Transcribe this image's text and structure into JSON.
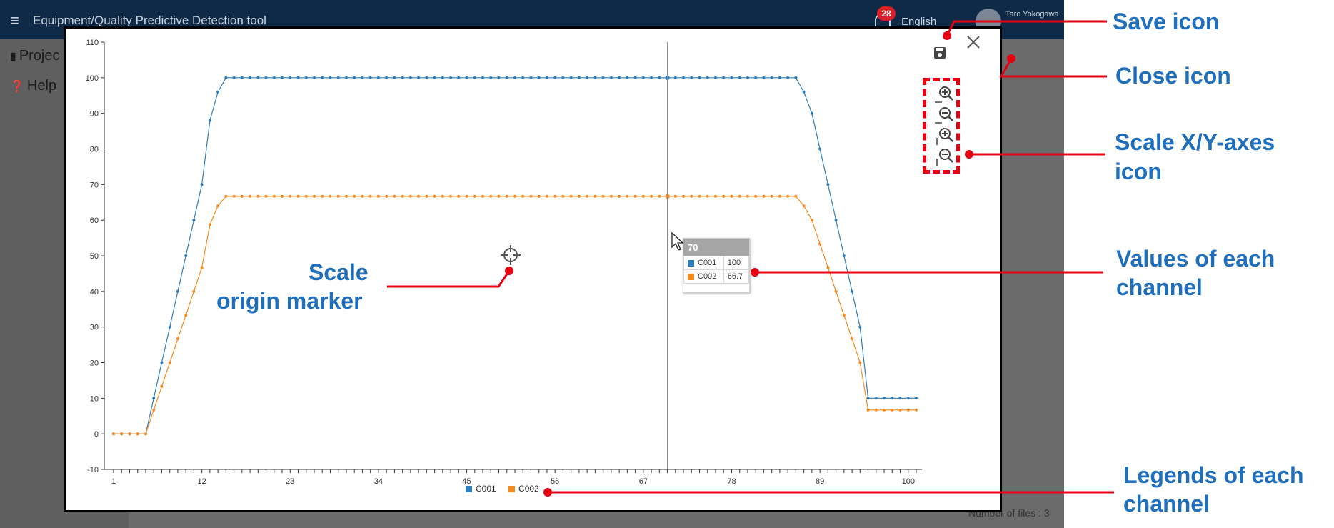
{
  "app": {
    "title": "Equipment/Quality Predictive Detection tool",
    "menu_icon": "hamburger-icon",
    "notification_count": "28",
    "language": "English",
    "user_name": "Taro Yokogawa",
    "sidebar_items": [
      {
        "label": "Projec",
        "icon": "bar-chart-icon"
      },
      {
        "label": "Help",
        "icon": "help-icon"
      }
    ],
    "files_count": "Number of files : 3"
  },
  "modal": {
    "save_icon": "save-icon",
    "close_icon": "close-icon",
    "zoom_icons": [
      "x-zoom-in-icon",
      "x-zoom-out-icon",
      "y-zoom-in-icon",
      "y-zoom-out-icon"
    ],
    "origin_marker_icon": "crosshair-icon"
  },
  "tooltip": {
    "x": "70",
    "rows": [
      {
        "channel": "C001",
        "value": "100",
        "color": "#2f7ebc"
      },
      {
        "channel": "C002",
        "value": "66.7",
        "color": "#f58a1f"
      }
    ]
  },
  "annotations": {
    "save": "Save icon",
    "close": "Close icon",
    "scale_line1": "Scale X/Y-axes",
    "scale_line2": "icon",
    "values_line1": "Values of each",
    "values_line2": "channel",
    "origin_line1": "Scale",
    "origin_line2": "origin marker",
    "legend_line1": "Legends of each",
    "legend_line2": "channel"
  },
  "chart_data": {
    "type": "line",
    "title": "",
    "xlabel": "",
    "ylabel": "",
    "xlim": [
      1,
      101
    ],
    "ylim": [
      -10,
      110
    ],
    "x_ticks": [
      1,
      12,
      23,
      34,
      45,
      56,
      67,
      78,
      89,
      100
    ],
    "y_ticks": [
      -10,
      0,
      10,
      20,
      30,
      40,
      50,
      60,
      70,
      80,
      90,
      100,
      110
    ],
    "grid": false,
    "legend": "bottom-center",
    "crosshair_x": 70,
    "series": [
      {
        "name": "C001",
        "color": "#2f7ebc",
        "points": [
          [
            1,
            0
          ],
          [
            2,
            0
          ],
          [
            3,
            0
          ],
          [
            4,
            0
          ],
          [
            5,
            0
          ],
          [
            6,
            10
          ],
          [
            7,
            20
          ],
          [
            8,
            30
          ],
          [
            9,
            40
          ],
          [
            10,
            50
          ],
          [
            11,
            60
          ],
          [
            12,
            70
          ],
          [
            13,
            88
          ],
          [
            14,
            96
          ],
          [
            15,
            100
          ],
          [
            86,
            100
          ],
          [
            87,
            96
          ],
          [
            88,
            90
          ],
          [
            89,
            80
          ],
          [
            90,
            70
          ],
          [
            91,
            60
          ],
          [
            92,
            50
          ],
          [
            93,
            40
          ],
          [
            94,
            30
          ],
          [
            95,
            10
          ],
          [
            101,
            10
          ]
        ]
      },
      {
        "name": "C002",
        "color": "#f58a1f",
        "points": [
          [
            1,
            0
          ],
          [
            2,
            0
          ],
          [
            3,
            0
          ],
          [
            4,
            0
          ],
          [
            5,
            0
          ],
          [
            6,
            6.7
          ],
          [
            7,
            13.3
          ],
          [
            8,
            20
          ],
          [
            9,
            26.7
          ],
          [
            10,
            33.3
          ],
          [
            11,
            40
          ],
          [
            12,
            46.7
          ],
          [
            13,
            58.7
          ],
          [
            14,
            64
          ],
          [
            15,
            66.7
          ],
          [
            86,
            66.7
          ],
          [
            87,
            64
          ],
          [
            88,
            60
          ],
          [
            89,
            53.3
          ],
          [
            90,
            46.7
          ],
          [
            91,
            40
          ],
          [
            92,
            33.3
          ],
          [
            93,
            26.7
          ],
          [
            94,
            20
          ],
          [
            95,
            6.7
          ],
          [
            101,
            6.7
          ]
        ]
      }
    ]
  }
}
